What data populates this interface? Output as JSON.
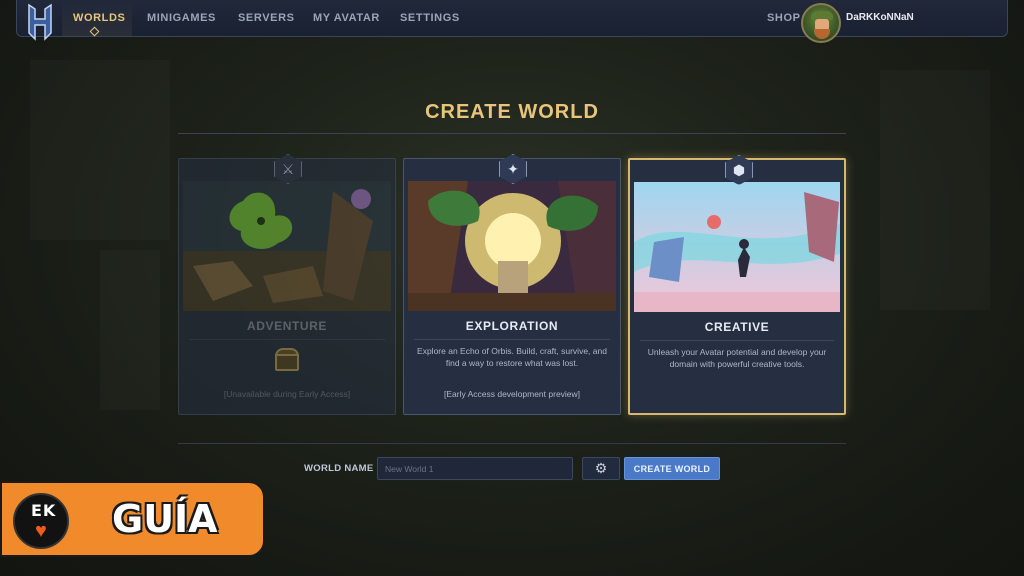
{
  "nav": {
    "items": [
      {
        "label": "WORLDS"
      },
      {
        "label": "MINIGAMES"
      },
      {
        "label": "SERVERS"
      },
      {
        "label": "MY AVATAR"
      },
      {
        "label": "SETTINGS"
      }
    ],
    "shop_label": "SHOP",
    "username": "DaRKKoNNaN",
    "active_color": "#e8c57a"
  },
  "page": {
    "title": "CREATE WORLD"
  },
  "cards": [
    {
      "title": "ADVENTURE",
      "icon": "swords-icon",
      "note": "[Unavailable during Early Access]",
      "state": "disabled"
    },
    {
      "title": "EXPLORATION",
      "icon": "compass-icon",
      "desc": "Explore an Echo of Orbis. Build, craft, survive, and find a way to restore what was lost.",
      "note": "[Early Access development preview]",
      "state": "available"
    },
    {
      "title": "CREATIVE",
      "icon": "cube-icon",
      "desc": "Unleash your Avatar potential and develop your domain with powerful creative tools.",
      "state": "selected"
    }
  ],
  "form": {
    "world_name_label": "WORLD NAME",
    "world_name_placeholder": "New World 1",
    "create_label": "CREATE WORLD",
    "button_color": "#4a79c8"
  },
  "overlay": {
    "logo_text": "EK",
    "guide_text": "GUÍA",
    "badge_color": "#f08a2a"
  }
}
